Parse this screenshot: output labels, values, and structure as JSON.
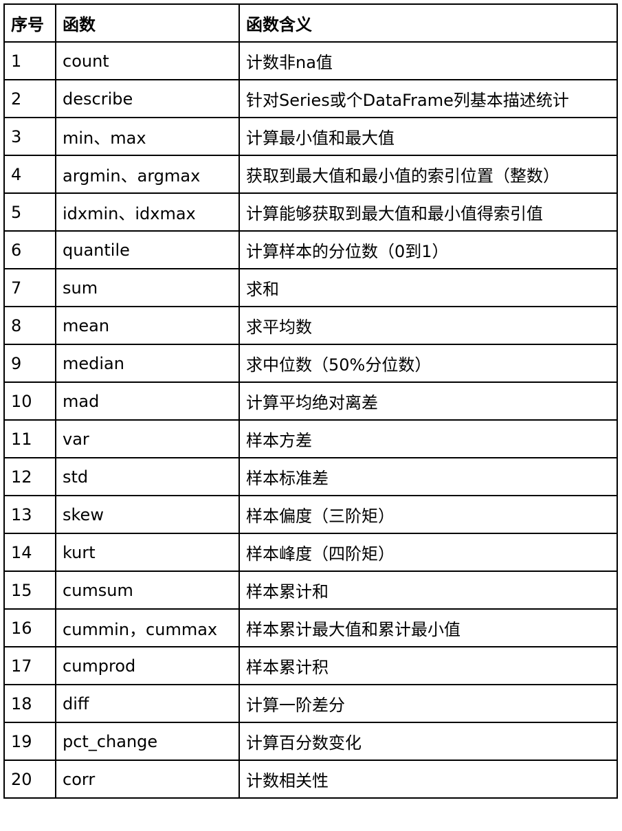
{
  "table": {
    "headers": [
      "序号",
      "函数",
      "函数含义"
    ],
    "rows": [
      [
        "1",
        "count",
        "计数非na值"
      ],
      [
        "2",
        "describe",
        "针对Series或个DataFrame列基本描述统计"
      ],
      [
        "3",
        "min、max",
        "计算最小值和最大值"
      ],
      [
        "4",
        "argmin、argmax",
        "获取到最大值和最小值的索引位置（整数）"
      ],
      [
        "5",
        "idxmin、idxmax",
        "计算能够获取到最大值和最小值得索引值"
      ],
      [
        "6",
        "quantile",
        "计算样本的分位数（0到1）"
      ],
      [
        "7",
        "sum",
        "求和"
      ],
      [
        "8",
        "mean",
        "求平均数"
      ],
      [
        "9",
        "median",
        "求中位数（50%分位数）"
      ],
      [
        "10",
        "mad",
        "计算平均绝对离差"
      ],
      [
        "11",
        "var",
        "样本方差"
      ],
      [
        "12",
        "std",
        "样本标准差"
      ],
      [
        "13",
        "skew",
        "样本偏度（三阶矩）"
      ],
      [
        "14",
        "kurt",
        "样本峰度（四阶矩）"
      ],
      [
        "15",
        "cumsum",
        "样本累计和"
      ],
      [
        "16",
        "cummin，cummax",
        "样本累计最大值和累计最小值"
      ],
      [
        "17",
        "cumprod",
        "样本累计积"
      ],
      [
        "18",
        "diff",
        "计算一阶差分"
      ],
      [
        "19",
        "pct_change",
        "计算百分数变化"
      ],
      [
        "20",
        "corr",
        "计数相关性"
      ]
    ]
  }
}
